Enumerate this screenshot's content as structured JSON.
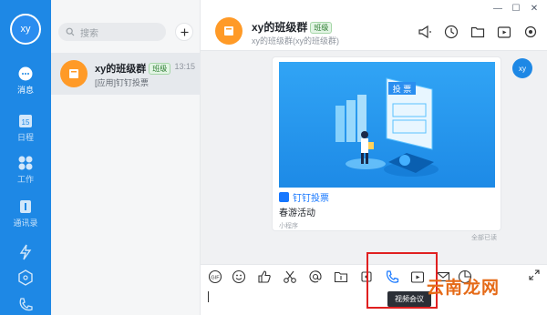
{
  "rail": {
    "avatar_text": "xy",
    "items": [
      {
        "label": "消息",
        "icon": "chat-bubble-icon"
      },
      {
        "label": "日程",
        "icon": "calendar-icon"
      },
      {
        "label": "工作",
        "icon": "grid-icon"
      },
      {
        "label": "通讯录",
        "icon": "contacts-icon"
      },
      {
        "label": "",
        "icon": "lightning-icon"
      },
      {
        "label": "",
        "icon": "cube-icon"
      },
      {
        "label": "",
        "icon": "phone-icon"
      }
    ],
    "calendar_day": "15"
  },
  "list": {
    "search_placeholder": "搜索",
    "conversations": [
      {
        "name": "xy的班级群",
        "badge": "班级",
        "time": "13:15",
        "preview": "[应用]钉钉投票"
      }
    ]
  },
  "chat": {
    "title": "xy的班级群",
    "badge": "班级",
    "subtitle": "xy的班级群(xy的班级群)",
    "sender_avatar": "xy",
    "card": {
      "image_text": "投 票",
      "brand": "钉钉投票",
      "title": "春游活动",
      "footer": "小程序"
    },
    "read_status": "全部已读"
  },
  "toolbar": {
    "tools": [
      "gif-icon",
      "emoji-icon",
      "thumbs-up-icon",
      "scissors-icon",
      "at-icon",
      "folder-icon",
      "screen-record-icon",
      "video-call-icon",
      "live-icon",
      "mail-icon",
      "poll-icon"
    ],
    "tooltip": "视频会议"
  },
  "watermark": "云南龙网",
  "colors": {
    "rail": "#1e88e5",
    "accent": "#1677ff",
    "group_avatar": "#ff9a27",
    "highlight": "#e02020"
  }
}
